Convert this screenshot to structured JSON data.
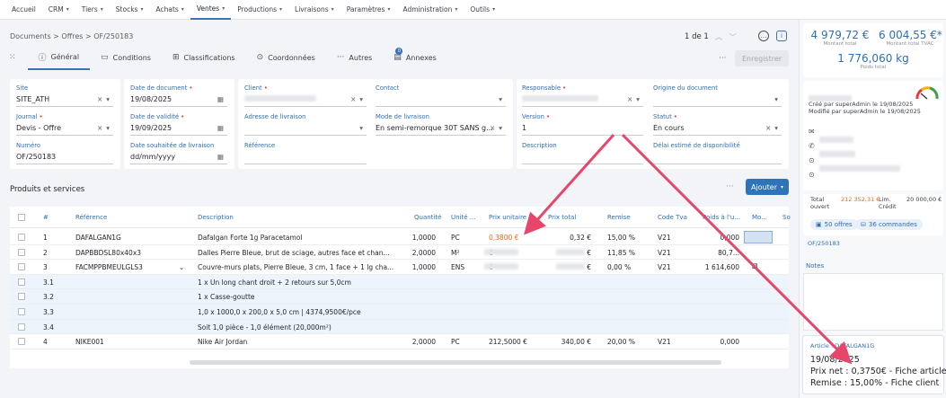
{
  "nav": {
    "items": [
      {
        "label": "Accueil",
        "caret": false
      },
      {
        "label": "CRM",
        "caret": true
      },
      {
        "label": "Tiers",
        "caret": true
      },
      {
        "label": "Stocks",
        "caret": true
      },
      {
        "label": "Achats",
        "caret": true
      },
      {
        "label": "Ventes",
        "caret": true,
        "active": true
      },
      {
        "label": "Productions",
        "caret": true
      },
      {
        "label": "Livraisons",
        "caret": true
      },
      {
        "label": "Paramètres",
        "caret": true
      },
      {
        "label": "Administration",
        "caret": true
      },
      {
        "label": "Outils",
        "caret": true
      }
    ]
  },
  "breadcrumb": "Documents > Offres > OF/250183",
  "pager": {
    "label": "1 de 1"
  },
  "tabs": [
    "Général",
    "Conditions",
    "Classifications",
    "Coordonnées",
    "Autres",
    "Annexes"
  ],
  "annex_count": "0",
  "save_label": "Enregistrer",
  "form": {
    "site": {
      "label": "Site",
      "value": "SITE_ATH"
    },
    "journal": {
      "label": "Journal",
      "value": "Devis - Offre"
    },
    "numero": {
      "label": "Numéro",
      "value": "OF/250183"
    },
    "date_document": {
      "label": "Date de document",
      "value": "19/08/2025"
    },
    "date_validite": {
      "label": "Date de validité",
      "value": "19/09/2025"
    },
    "date_souhaitee": {
      "label": "Date souhaitée de livraison",
      "placeholder": "dd/mm/yyyy"
    },
    "client": {
      "label": "Client"
    },
    "adresse": {
      "label": "Adresse de livraison"
    },
    "reference": {
      "label": "Référence"
    },
    "contact": {
      "label": "Contact"
    },
    "mode_livraison": {
      "label": "Mode de livraison",
      "value": "En semi-remorque 30T SANS g..."
    },
    "responsable": {
      "label": "Responsable"
    },
    "version": {
      "label": "Version",
      "value": "1"
    },
    "description": {
      "label": "Description"
    },
    "origine": {
      "label": "Origine du document"
    },
    "statut": {
      "label": "Statut",
      "value": "En cours"
    },
    "delai": {
      "label": "Délai estimé de disponibilité"
    }
  },
  "products": {
    "title": "Produits et services",
    "add_label": "Ajouter",
    "columns": [
      "#",
      "Référence",
      "Description",
      "Quantité",
      "Unité ...",
      "Prix unitaire",
      "Prix total",
      "Remise",
      "Code Tva",
      "Poids à l'u...",
      "Mo...",
      "So"
    ],
    "rows": [
      {
        "n": "1",
        "ref": "DAFALGAN1G",
        "desc": "Dafalgan Forte 1g Paracetamol",
        "qty": "1,0000",
        "unit": "PC",
        "pu": "0,3800 €",
        "pt": "0,32 €",
        "remise": "15,00 %",
        "tva": "V21",
        "poids": "0,000",
        "sub": false
      },
      {
        "n": "2",
        "ref": "DAPBBDSL80x40x3",
        "desc": "Dalles Pierre Bleue, brut de sciage, autres face et chan...",
        "qty": "2,0000",
        "unit": "M²",
        "pu": "€",
        "pt": "€",
        "remise": "11,85 %",
        "tva": "V21",
        "poids": "80,7...",
        "sub": false
      },
      {
        "n": "3",
        "ref": "FACMPPBMEULGLS3",
        "desc": "Couvre-murs plats, Pierre Bleue, 3 cm, 1 face + 1 lg cha...",
        "qty": "1,0000",
        "unit": "ENS",
        "pu": "€",
        "pt": "€",
        "remise": "0,00 %",
        "tva": "V21",
        "poids": "1 614,600",
        "sub": false
      },
      {
        "n": "3.1",
        "ref": "",
        "desc": "1 x Un long chant droit + 2 retours sur 5,0cm",
        "sub": true
      },
      {
        "n": "3.2",
        "ref": "",
        "desc": "1 x Casse-goutte",
        "sub": true
      },
      {
        "n": "3.3",
        "ref": "",
        "desc": "1,0 x 1000,0 x 200,0 x 5,0 cm | 4374,9500€/pce",
        "sub": true
      },
      {
        "n": "3.4",
        "ref": "",
        "desc": "Soit 1,0 pièce - 1,0 élément (20,000m²)",
        "sub": true
      },
      {
        "n": "4",
        "ref": "NIKE001",
        "desc": "Nike Air Jordan",
        "qty": "2,0000",
        "unit": "PC",
        "pu": "212,5000 €",
        "pt": "340,00 €",
        "remise": "20,00 %",
        "tva": "V21",
        "poids": "0,000",
        "sub": false
      }
    ]
  },
  "sidebar": {
    "amount_ht": "4 979,72 €",
    "amount_ht_label": "Montant total",
    "amount_tvac": "6 004,55 €*",
    "amount_tvac_label": "Montant total TVAC",
    "weight": "1 776,060 kg",
    "weight_label": "Poids total",
    "created": "Créé par superAdmin le 19/08/2025",
    "modified": "Modifié par superAdmin le 19/08/2025",
    "total_label": "Total",
    "ouvert_label": "ouvert",
    "total_value": "212 352,31 €",
    "lim_label": "Lim.",
    "credit_label": "Crédit",
    "credit_value": "20 000,00 €",
    "offers_label": "50 offres",
    "orders_label": "36 commandes",
    "doc_link": "OF/250183",
    "notes_label": "Notes",
    "gauge_color": "#e53935"
  },
  "tooltip": {
    "title": "Article : DAFALGAN1G",
    "date": "19/08/2025",
    "line1": "Prix net : 0,3750€ - Fiche article",
    "line2": "Remise : 15,00% - Fiche client"
  },
  "colors": {
    "accent": "#2f73b8",
    "arrow": "#e8456b",
    "orange": "#e86a18"
  }
}
